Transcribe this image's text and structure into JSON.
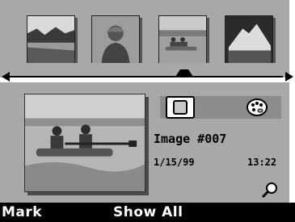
{
  "filmstrip": {
    "thumbnails": [
      {
        "subject": "lake-landscape"
      },
      {
        "subject": "person-portrait"
      },
      {
        "subject": "kayakers"
      },
      {
        "subject": "snowy-mountain"
      }
    ],
    "selected_index": 2
  },
  "details": {
    "image_title": "Image #007",
    "date": "1/15/99",
    "time": "13:22"
  },
  "icons": {
    "view_toggle": "view-toggle-icon",
    "palette": "palette-icon",
    "zoom": "magnifier-icon",
    "scroll_left": "arrow-left-icon",
    "scroll_right": "arrow-right-icon",
    "selection_marker": "selection-marker-icon"
  },
  "softkeys": {
    "left_label": "Mark",
    "right_label": "Show All"
  },
  "colors": {
    "panel": "#a8a8a8",
    "softkey_bar": "#000000",
    "softkey_text": "#ffffff"
  }
}
